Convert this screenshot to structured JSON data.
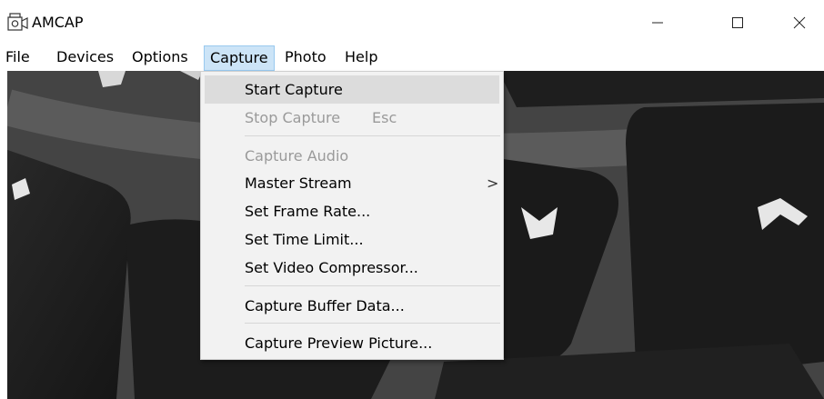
{
  "window": {
    "title": "AMCAP",
    "icon": "camera-app-icon",
    "controls": [
      "minimize-icon",
      "maximize-icon",
      "close-icon"
    ]
  },
  "menubar": {
    "items": [
      {
        "label": "File"
      },
      {
        "label": "Devices"
      },
      {
        "label": "Options"
      },
      {
        "label": "Capture",
        "active": true
      },
      {
        "label": "Photo"
      },
      {
        "label": "Help"
      }
    ]
  },
  "capture_menu": {
    "items": [
      {
        "label": "Start Capture",
        "highlighted": true
      },
      {
        "label": "Stop Capture",
        "shortcut": "Esc",
        "disabled": true
      },
      {
        "label": "Capture Audio",
        "disabled": true
      },
      {
        "label": "Master Stream",
        "submenu_arrow": ">"
      },
      {
        "label": "Set Frame Rate..."
      },
      {
        "label": "Set Time Limit..."
      },
      {
        "label": "Set Video Compressor..."
      },
      {
        "label": "Capture Buffer Data..."
      },
      {
        "label": "Capture Preview Picture..."
      }
    ]
  },
  "preview": {
    "content": "keyboard-keys-video-preview"
  }
}
